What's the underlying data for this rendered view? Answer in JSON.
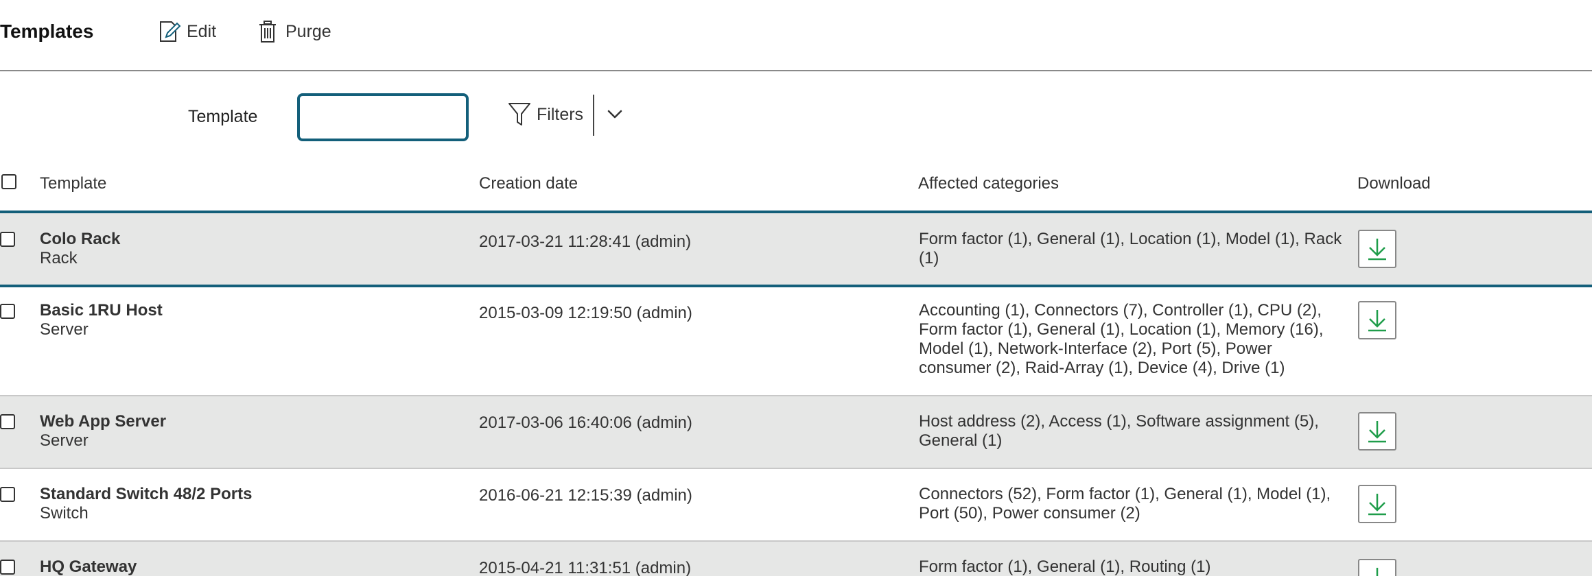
{
  "toolbar": {
    "title": "Templates",
    "edit_label": "Edit",
    "purge_label": "Purge"
  },
  "filter": {
    "label": "Template",
    "input_value": "",
    "filters_label": "Filters"
  },
  "table": {
    "headers": {
      "template": "Template",
      "creation_date": "Creation date",
      "categories": "Affected categories",
      "download": "Download"
    },
    "rows": [
      {
        "name": "Colo Rack",
        "type": "Rack",
        "date": "2017-03-21 11:28:41 (admin)",
        "categories": "Form factor (1), General (1), Location (1), Model (1), Rack (1)"
      },
      {
        "name": "Basic 1RU Host",
        "type": "Server",
        "date": "2015-03-09 12:19:50 (admin)",
        "categories": "Accounting (1), Connectors (7), Controller (1), CPU (2), Form factor (1), General (1), Location (1), Memory (16), Model (1), Network-Interface (2), Port (5), Power consumer (2), Raid-Array (1), Device (4), Drive (1)"
      },
      {
        "name": "Web App Server",
        "type": "Server",
        "date": "2017-03-06 16:40:06 (admin)",
        "categories": "Host address (2), Access (1), Software assignment (5), General (1)"
      },
      {
        "name": "Standard Switch 48/2 Ports",
        "type": "Switch",
        "date": "2016-06-21 12:15:39 (admin)",
        "categories": "Connectors (52), Form factor (1), General (1), Model (1), Port (50), Power consumer (2)"
      },
      {
        "name": "HQ Gateway",
        "type": "",
        "date": "2015-04-21 11:31:51 (admin)",
        "categories": "Form factor (1), General (1), Routing (1)"
      }
    ]
  },
  "icons": {
    "edit": "edit-icon",
    "purge": "trash-icon",
    "filter": "funnel-icon",
    "caret": "chevron-down-icon",
    "download": "download-icon"
  },
  "colors": {
    "accent": "#135f7a",
    "download_icon": "#1f9d4a",
    "row_alt": "#e6e7e6"
  }
}
